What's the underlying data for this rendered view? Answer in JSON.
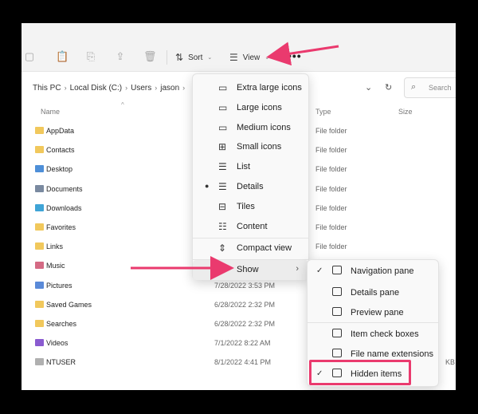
{
  "toolbar": {
    "sort_label": "Sort",
    "view_label": "View",
    "more_label": "•••"
  },
  "address": {
    "crumbs": [
      "This PC",
      "Local Disk (C:)",
      "Users",
      "jason"
    ],
    "search_placeholder": "Search"
  },
  "columns": {
    "name": "Name",
    "type": "Type",
    "size": "Size"
  },
  "files": [
    {
      "name": "AppData",
      "date": "",
      "type": "File folder",
      "size": ""
    },
    {
      "name": "Contacts",
      "date": "",
      "type": "File folder",
      "size": ""
    },
    {
      "name": "Desktop",
      "date": "",
      "type": "File folder",
      "size": ""
    },
    {
      "name": "Documents",
      "date": "",
      "type": "File folder",
      "size": ""
    },
    {
      "name": "Downloads",
      "date": "",
      "type": "File folder",
      "size": ""
    },
    {
      "name": "Favorites",
      "date": "",
      "type": "File folder",
      "size": ""
    },
    {
      "name": "Links",
      "date": "",
      "type": "File folder",
      "size": ""
    },
    {
      "name": "Music",
      "date": "",
      "type": "",
      "size": ""
    },
    {
      "name": "Pictures",
      "date": "7/28/2022 3:53 PM",
      "type": "",
      "size": ""
    },
    {
      "name": "Saved Games",
      "date": "6/28/2022 2:32 PM",
      "type": "",
      "size": ""
    },
    {
      "name": "Searches",
      "date": "6/28/2022 2:32 PM",
      "type": "",
      "size": ""
    },
    {
      "name": "Videos",
      "date": "7/1/2022 8:22 AM",
      "type": "",
      "size": ""
    },
    {
      "name": "NTUSER",
      "date": "8/1/2022 4:41 PM",
      "type": "",
      "size": "KB"
    }
  ],
  "view_menu": {
    "items": [
      {
        "label": "Extra large icons",
        "icon": "monitor-icon"
      },
      {
        "label": "Large icons",
        "icon": "monitor-icon"
      },
      {
        "label": "Medium icons",
        "icon": "monitor-icon"
      },
      {
        "label": "Small icons",
        "icon": "grid-icon"
      },
      {
        "label": "List",
        "icon": "list-icon"
      },
      {
        "label": "Details",
        "icon": "details-icon",
        "selected": true
      },
      {
        "label": "Tiles",
        "icon": "tiles-icon"
      },
      {
        "label": "Content",
        "icon": "content-icon"
      }
    ],
    "compact_label": "Compact view",
    "show_label": "Show"
  },
  "show_menu": {
    "items": [
      {
        "label": "Navigation pane",
        "checked": true
      },
      {
        "label": "Details pane",
        "checked": false
      },
      {
        "label": "Preview pane",
        "checked": false
      },
      {
        "label": "Item check boxes",
        "checked": false
      },
      {
        "label": "File name extensions",
        "checked": false
      },
      {
        "label": "Hidden items",
        "checked": true
      }
    ]
  },
  "colors": {
    "accent_pink": "#ea3a6e",
    "folder": "#f1c85c"
  }
}
